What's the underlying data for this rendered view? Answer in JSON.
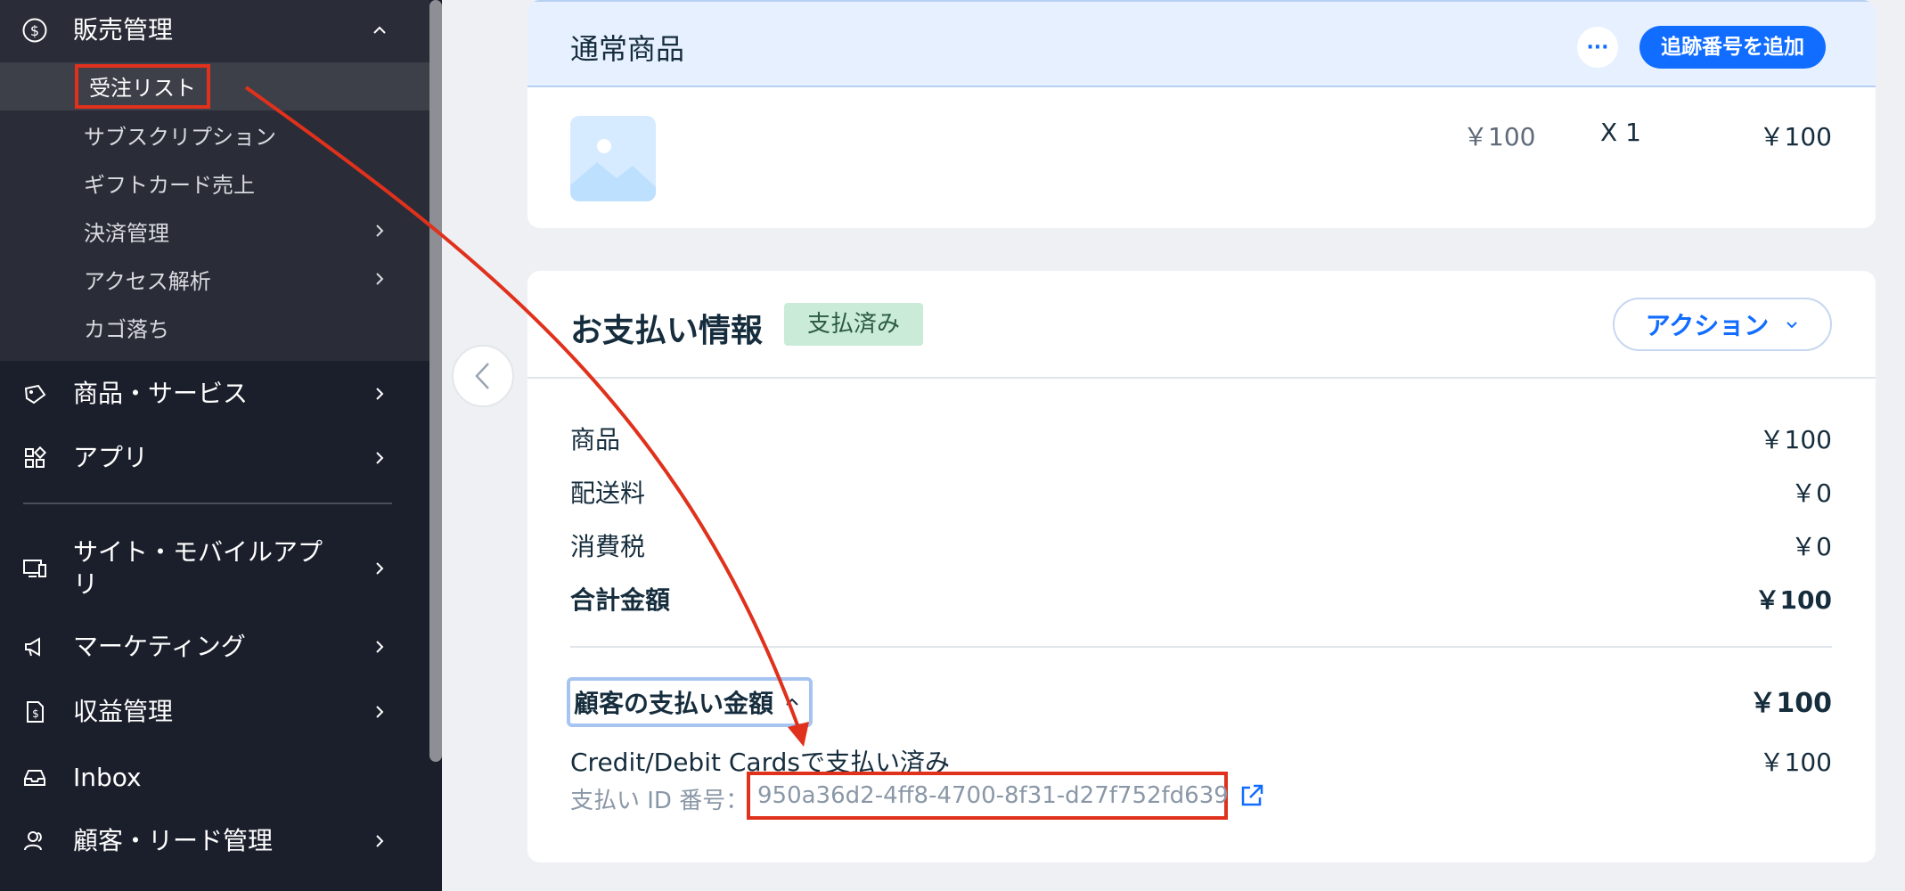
{
  "sidebar": {
    "sales": {
      "label": "販売管理"
    },
    "sub_items": [
      {
        "label": "受注リスト"
      },
      {
        "label": "サブスクリプション"
      },
      {
        "label": "ギフトカード売上"
      },
      {
        "label": "決済管理"
      },
      {
        "label": "アクセス解析"
      },
      {
        "label": "カゴ落ち"
      }
    ],
    "items": [
      {
        "label": "商品・サービス"
      },
      {
        "label": "アプリ"
      },
      {
        "label": "サイト・モバイルアプリ"
      },
      {
        "label": "マーケティング"
      },
      {
        "label": "収益管理"
      },
      {
        "label": "Inbox"
      },
      {
        "label": "顧客・リード管理"
      }
    ]
  },
  "products": {
    "title": "通常商品",
    "more_label": "···",
    "tracking_label": "追跡番号を追加",
    "line": {
      "unit_price": "￥100",
      "quantity": "X 1",
      "total": "￥100"
    }
  },
  "payment": {
    "title": "お支払い情報",
    "status_badge": "支払済み",
    "action_label": "アクション",
    "summary": [
      {
        "label": "商品",
        "value": "￥100"
      },
      {
        "label": "配送料",
        "value": "￥0"
      },
      {
        "label": "消費税",
        "value": "￥0"
      }
    ],
    "total": {
      "label": "合計金額",
      "value": "￥100"
    },
    "customer_paid": {
      "label": "顧客の支払い金額",
      "value": "￥100"
    },
    "method": {
      "label": "Credit/Debit Cardsで支払い済み",
      "value": "￥100"
    },
    "payment_id": {
      "label": "支払い ID 番号：",
      "value": "950a36d2-4ff8-4700-8f31-d27f752fd639"
    }
  },
  "colors": {
    "accent": "#116dff",
    "highlight": "#e0311c",
    "sidebar_bg": "#1b1f2b",
    "paid_badge_bg": "#c9ebd8"
  }
}
